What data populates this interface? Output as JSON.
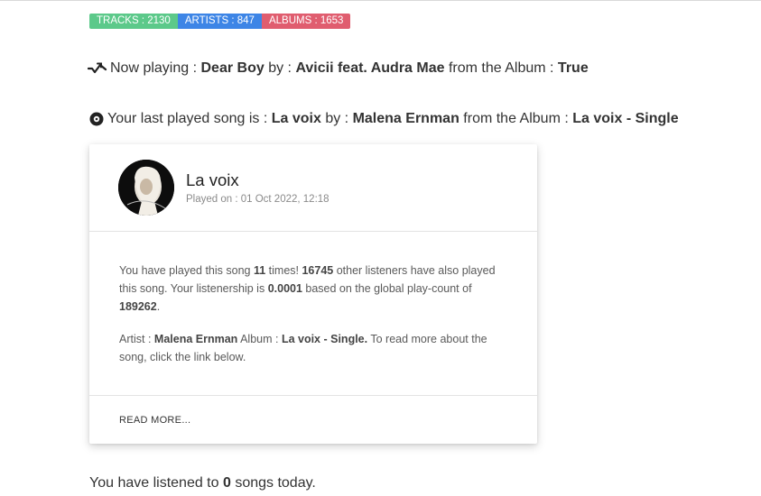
{
  "badges": {
    "tracks": "TRACKS : 2130",
    "artists": "ARTISTS : 847",
    "albums": "ALBUMS : 1653"
  },
  "now_playing": {
    "prefix": "Now playing : ",
    "song": "Dear Boy",
    "by_label": " by : ",
    "artist": "Avicii feat. Audra Mae",
    "album_label": " from the Album : ",
    "album": "True",
    "icon": "trending-icon"
  },
  "last_played": {
    "prefix": "Your last played song is : ",
    "song": "La voix",
    "by_label": " by : ",
    "artist": "Malena Ernman",
    "album_label": " from the Album : ",
    "album": "La voix - Single",
    "icon": "record-icon"
  },
  "card": {
    "title": "La voix",
    "played_on": "Played on : 01 Oct 2022, 12:18",
    "para1": {
      "t1": "You have played this song ",
      "times": "11",
      "t2": " times! ",
      "listeners": "16745",
      "t3": " other listeners have also played this song. Your listenership is ",
      "listenership": "0.0001",
      "t4": " based on the global play-count of ",
      "global_count": "189262",
      "t5": "."
    },
    "para2": {
      "artist_label": "Artist : ",
      "artist": "Malena Ernman",
      "album_label": " Album : ",
      "album": "La voix - Single.",
      "t1": " To read more about the song, click the link below."
    },
    "read_more": "READ MORE..."
  },
  "today": {
    "t1": "You have listened to ",
    "count": "0",
    "t2": " songs today."
  }
}
